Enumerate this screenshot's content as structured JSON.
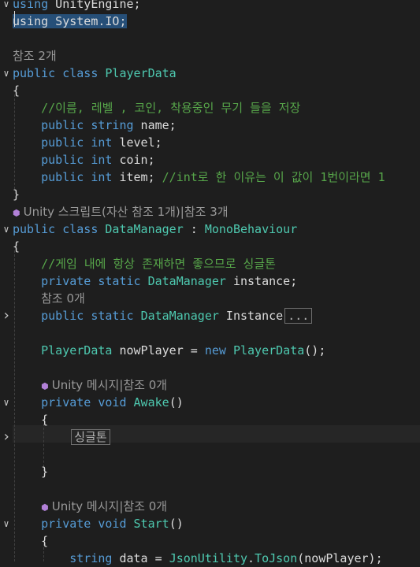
{
  "lines": [
    {
      "code": [
        {
          "t": "using",
          "c": "kw"
        },
        {
          "t": " UnityEngine;",
          "c": "id"
        }
      ]
    },
    {
      "code": [
        {
          "t": "using System.IO;",
          "c": "sel"
        }
      ]
    },
    {
      "code": []
    },
    {
      "lens": "참조 2개"
    },
    {
      "code": [
        {
          "t": "public",
          "c": "kw"
        },
        {
          "t": " ",
          "c": "id"
        },
        {
          "t": "class",
          "c": "kw"
        },
        {
          "t": " ",
          "c": "id"
        },
        {
          "t": "PlayerData",
          "c": "ty"
        }
      ]
    },
    {
      "code": [
        {
          "t": "{",
          "c": "id"
        }
      ]
    },
    {
      "code": [
        {
          "t": "    //이름, 레벨 , 코인, 착용중인 무기 들을 저장",
          "c": "cm"
        }
      ]
    },
    {
      "code": [
        {
          "t": "    public",
          "c": "kw"
        },
        {
          "t": " ",
          "c": "id"
        },
        {
          "t": "string",
          "c": "kw"
        },
        {
          "t": " name;",
          "c": "id"
        }
      ]
    },
    {
      "code": [
        {
          "t": "    public",
          "c": "kw"
        },
        {
          "t": " ",
          "c": "id"
        },
        {
          "t": "int",
          "c": "kw"
        },
        {
          "t": " level;",
          "c": "id"
        }
      ]
    },
    {
      "code": [
        {
          "t": "    public",
          "c": "kw"
        },
        {
          "t": " ",
          "c": "id"
        },
        {
          "t": "int",
          "c": "kw"
        },
        {
          "t": " coin;",
          "c": "id"
        }
      ]
    },
    {
      "code": [
        {
          "t": "    public",
          "c": "kw"
        },
        {
          "t": " ",
          "c": "id"
        },
        {
          "t": "int",
          "c": "kw"
        },
        {
          "t": " item; ",
          "c": "id"
        },
        {
          "t": "//int로 한 이유는 이 값이 1번이라면 1",
          "c": "cm"
        }
      ]
    },
    {
      "code": [
        {
          "t": "}",
          "c": "id"
        }
      ]
    },
    {
      "lens": "Unity 스크립트(자산 참조 1개)|참조 3개",
      "lensIcon": true
    },
    {
      "code": [
        {
          "t": "public",
          "c": "kw"
        },
        {
          "t": " ",
          "c": "id"
        },
        {
          "t": "class",
          "c": "kw"
        },
        {
          "t": " ",
          "c": "id"
        },
        {
          "t": "DataManager",
          "c": "ty"
        },
        {
          "t": " : ",
          "c": "id"
        },
        {
          "t": "MonoBehaviour",
          "c": "ty"
        }
      ]
    },
    {
      "code": [
        {
          "t": "{",
          "c": "id"
        }
      ]
    },
    {
      "code": [
        {
          "t": "    //게임 내에 항상 존재하면 좋으므로 싱글톤",
          "c": "cm"
        }
      ]
    },
    {
      "code": [
        {
          "t": "    private",
          "c": "kw"
        },
        {
          "t": " ",
          "c": "id"
        },
        {
          "t": "static",
          "c": "kw"
        },
        {
          "t": " ",
          "c": "id"
        },
        {
          "t": "DataManager",
          "c": "ty"
        },
        {
          "t": " instance;",
          "c": "id"
        }
      ]
    },
    {
      "lens": "    참조 0개"
    },
    {
      "code": [
        {
          "t": "    public",
          "c": "kw"
        },
        {
          "t": " ",
          "c": "id"
        },
        {
          "t": "static",
          "c": "kw"
        },
        {
          "t": " ",
          "c": "id"
        },
        {
          "t": "DataManager",
          "c": "ty"
        },
        {
          "t": " Instance",
          "c": "id"
        },
        {
          "t": "...",
          "c": "collapsed"
        }
      ]
    },
    {
      "code": []
    },
    {
      "code": [
        {
          "t": "    PlayerData",
          "c": "ty"
        },
        {
          "t": " nowPlayer = ",
          "c": "id"
        },
        {
          "t": "new",
          "c": "kw"
        },
        {
          "t": " ",
          "c": "id"
        },
        {
          "t": "PlayerData",
          "c": "ty"
        },
        {
          "t": "();",
          "c": "id"
        }
      ]
    },
    {
      "code": []
    },
    {
      "lens": "    Unity 메시지|참조 0개",
      "lensIcon": true
    },
    {
      "code": [
        {
          "t": "    private",
          "c": "kw"
        },
        {
          "t": " ",
          "c": "id"
        },
        {
          "t": "void",
          "c": "kw"
        },
        {
          "t": " ",
          "c": "id"
        },
        {
          "t": "Awake",
          "c": "ty"
        },
        {
          "t": "()",
          "c": "id"
        }
      ]
    },
    {
      "code": [
        {
          "t": "    {",
          "c": "id"
        }
      ]
    },
    {
      "code": [
        {
          "t": "        ",
          "c": "id"
        },
        {
          "t": "싱글톤",
          "c": "collapsed"
        }
      ]
    },
    {
      "code": []
    },
    {
      "code": [
        {
          "t": "    }",
          "c": "id"
        }
      ]
    },
    {
      "code": []
    },
    {
      "lens": "    Unity 메시지|참조 0개",
      "lensIcon": true
    },
    {
      "code": [
        {
          "t": "    private",
          "c": "kw"
        },
        {
          "t": " ",
          "c": "id"
        },
        {
          "t": "void",
          "c": "kw"
        },
        {
          "t": " ",
          "c": "id"
        },
        {
          "t": "Start",
          "c": "ty"
        },
        {
          "t": "()",
          "c": "id"
        }
      ]
    },
    {
      "code": [
        {
          "t": "    {",
          "c": "id"
        }
      ]
    },
    {
      "code": [
        {
          "t": "        ",
          "c": "id"
        },
        {
          "t": "string",
          "c": "kw"
        },
        {
          "t": " data = ",
          "c": "id"
        },
        {
          "t": "JsonUtility",
          "c": "ty"
        },
        {
          "t": ".",
          "c": "id"
        },
        {
          "t": "ToJson",
          "c": "ty"
        },
        {
          "t": "(nowPlayer);",
          "c": "id"
        }
      ]
    }
  ],
  "folds": {
    "0": "down",
    "4": "down",
    "13": "down",
    "18": "right",
    "23": "down",
    "25": "right",
    "30": "down"
  }
}
